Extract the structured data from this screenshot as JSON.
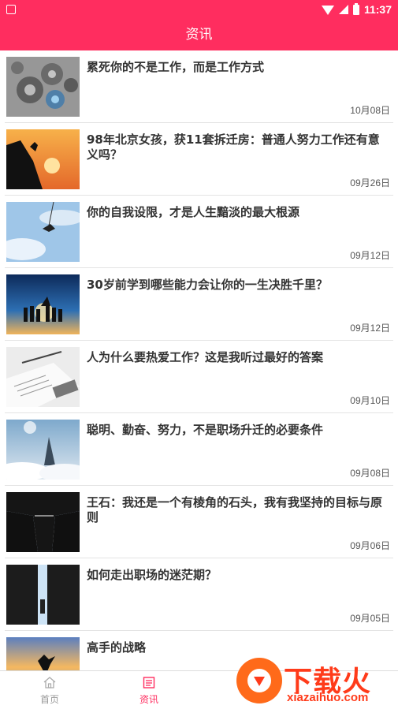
{
  "status": {
    "time": "11:37"
  },
  "header": {
    "title": "资讯"
  },
  "articles": [
    {
      "title": "累死你的不是工作，而是工作方式",
      "date": "10月08日",
      "image": "gears"
    },
    {
      "title": "98年北京女孩，获11套拆迁房：普通人努力工作还有意义吗？",
      "date": "09月26日",
      "image": "climber-sunset"
    },
    {
      "title": "你的自我设限，才是人生黯淡的最大根源",
      "date": "09月12日",
      "image": "bungee-sky"
    },
    {
      "title": "30岁前学到哪些能力会让你的一生决胜千里？",
      "date": "09月12日",
      "image": "team-silhouettes"
    },
    {
      "title": "人为什么要热爱工作？这是我听过最好的答案",
      "date": "09月10日",
      "image": "desk-papers"
    },
    {
      "title": "聪明、勤奋、努力，不是职场升迁的必要条件",
      "date": "09月08日",
      "image": "mountain-clouds"
    },
    {
      "title": "王石：我还是一个有棱角的石头，我有我坚持的目标与原则",
      "date": "09月06日",
      "image": "cliff-gap"
    },
    {
      "title": "如何走出职场的迷茫期？",
      "date": "09月05日",
      "image": "door-light"
    },
    {
      "title": "高手的战略",
      "date": "",
      "image": "karate-sunset"
    }
  ],
  "tabs": [
    {
      "label": "首页",
      "icon": "home-icon",
      "active": false
    },
    {
      "label": "资讯",
      "icon": "news-icon",
      "active": true
    }
  ],
  "watermark": {
    "brand": "下载火",
    "url": "xiazaihuo.com"
  },
  "colors": {
    "primary": "#ff2d5f",
    "watermark": "#ff3b1a"
  }
}
